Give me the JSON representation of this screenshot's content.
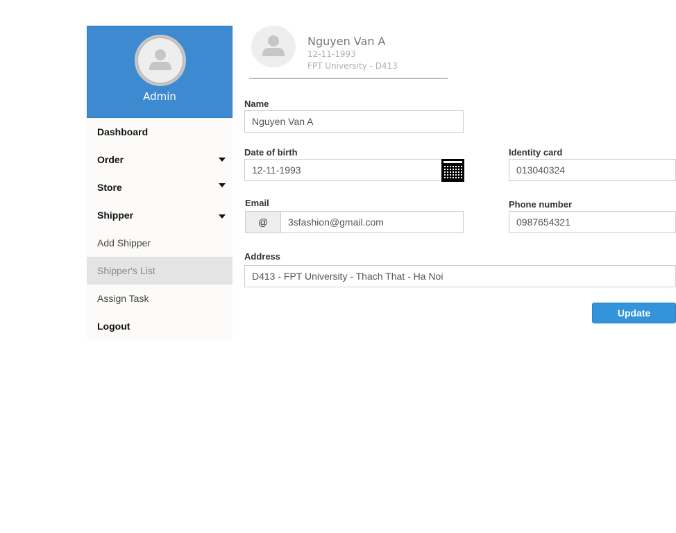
{
  "sidebar": {
    "profile": {
      "name": "Admin",
      "avatar_icon": "user-icon",
      "background_color": "#3d8ad1"
    },
    "menu": {
      "dashboard": "Dashboard",
      "order": "Order",
      "store": "Store",
      "shipper": "Shipper",
      "add_shipper": "Add Shipper",
      "shippers_list": "Shipper's List",
      "assign_task": "Assign Task",
      "logout": "Logout"
    },
    "active_item": "Shipper's List"
  },
  "header": {
    "name": "Nguyen Van A",
    "dob": "12-11-1993",
    "school": "FPT University - D413",
    "avatar_icon": "user-icon"
  },
  "form": {
    "name": {
      "label": "Name",
      "value": "Nguyen Van A"
    },
    "dob": {
      "label": "Date of birth",
      "value": "12-11-1993",
      "icon": "calendar-icon"
    },
    "identity_card": {
      "label": "Identity card",
      "value": "013040324"
    },
    "email": {
      "label": "Email",
      "addon": "@",
      "value": "3sfashion@gmail.com"
    },
    "phone": {
      "label": "Phone number",
      "value": "0987654321"
    },
    "address": {
      "label": "Address",
      "value": "D413 - FPT University - Thach That - Ha Noi"
    },
    "update_label": "Update",
    "accent_color": "#3393db"
  }
}
